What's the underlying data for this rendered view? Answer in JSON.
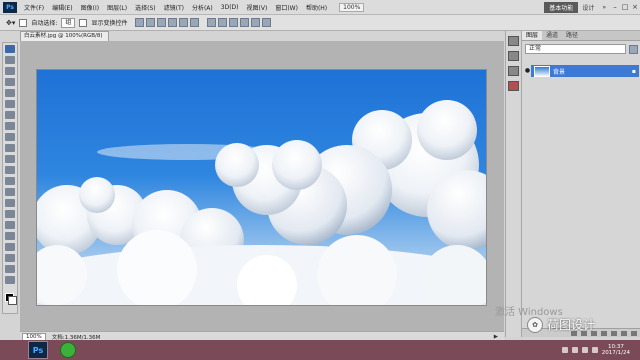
{
  "menubar": {
    "logo": "Ps",
    "items": [
      "文件(F)",
      "编辑(E)",
      "图像(I)",
      "图层(L)",
      "选择(S)",
      "滤镜(T)",
      "分析(A)",
      "3D(D)",
      "视图(V)",
      "窗口(W)",
      "帮助(H)"
    ],
    "zoom": "100%",
    "workspace": "基本功能",
    "design_link": "设计",
    "more": "»"
  },
  "options": {
    "auto_select_label": "自动选择:",
    "auto_select_value": "组",
    "show_transform_label": "显示变换控件"
  },
  "document": {
    "tab_title": "白云素材.jpg @ 100%(RGB/8)"
  },
  "status": {
    "zoom": "100%",
    "doc_size": "文档:1.36M/1.36M"
  },
  "panel": {
    "tabs": [
      "图层",
      "通道",
      "路径"
    ],
    "blend_mode": "正常",
    "layer_name": "背景"
  },
  "watermark": {
    "windows_text": "激活 Windows",
    "brand_icon": "✿",
    "brand_text": "荷图设计"
  },
  "taskbar": {
    "app_label": "Ps",
    "time": "10:37",
    "date": "2017/1/24"
  }
}
